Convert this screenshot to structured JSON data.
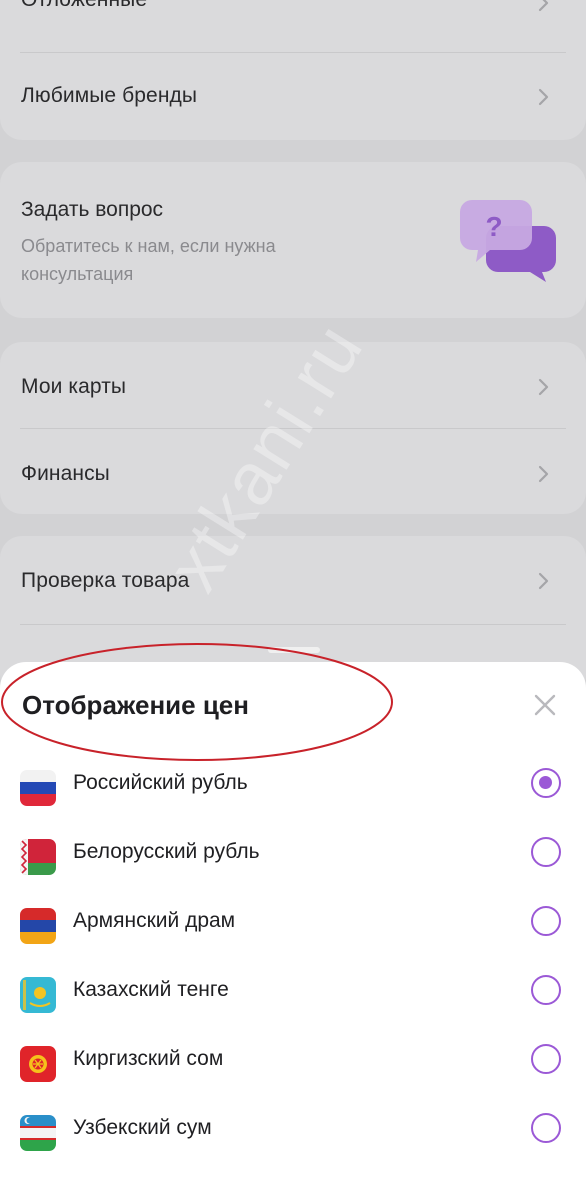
{
  "menu": {
    "items_top": [
      "Отложенные",
      "Любимые бренды"
    ],
    "ask": {
      "title": "Задать вопрос",
      "subtitle": "Обратитесь к нам, если нужна консультация",
      "icon": "chat-question-icon"
    },
    "items_mid": [
      "Мои карты",
      "Финансы"
    ],
    "items_bottom": [
      "Проверка товара"
    ]
  },
  "watermark": "xtkani.ru",
  "sheet": {
    "title": "Отображение цен",
    "close_icon": "close-icon",
    "accent_color": "#9b59d6",
    "currencies": [
      {
        "label": "Российский рубль",
        "flag": "flag-russia-icon",
        "selected": true
      },
      {
        "label": "Белорусский рубль",
        "flag": "flag-belarus-icon",
        "selected": false
      },
      {
        "label": "Армянский драм",
        "flag": "flag-armenia-icon",
        "selected": false
      },
      {
        "label": "Казахский тенге",
        "flag": "flag-kazakhstan-icon",
        "selected": false
      },
      {
        "label": "Киргизский сом",
        "flag": "flag-kyrgyzstan-icon",
        "selected": false
      },
      {
        "label": "Узбекский сум",
        "flag": "flag-uzbekistan-icon",
        "selected": false
      }
    ]
  }
}
